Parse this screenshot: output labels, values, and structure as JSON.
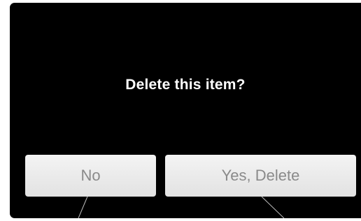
{
  "dialog": {
    "title": "Delete this item?",
    "no_label": "No",
    "yes_label": "Yes, Delete"
  },
  "colors": {
    "background": "#000000",
    "text": "#ffffff",
    "button_bg": "#e8e8e8",
    "button_text": "#8a8a8a"
  }
}
